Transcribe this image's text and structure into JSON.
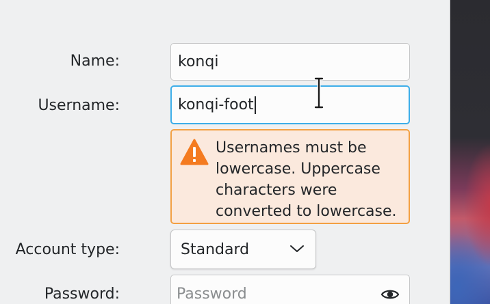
{
  "form": {
    "name_label": "Name:",
    "name_value": "konqi",
    "username_label": "Username:",
    "username_value": "konqi-foot",
    "warning_text": "Usernames must be lowercase. Uppercase characters were converted to lowercase.",
    "account_type_label": "Account type:",
    "account_type_value": "Standard",
    "password_label": "Password:",
    "password_placeholder": "Password"
  },
  "icons": {
    "warning": "warning-triangle-icon",
    "dropdown": "chevron-down-icon",
    "reveal": "eye-icon"
  },
  "colors": {
    "focus": "#3daee9",
    "warning_border": "#f3a043",
    "warning_bg": "#fbe9dd",
    "warning_icon": "#f47b20"
  }
}
